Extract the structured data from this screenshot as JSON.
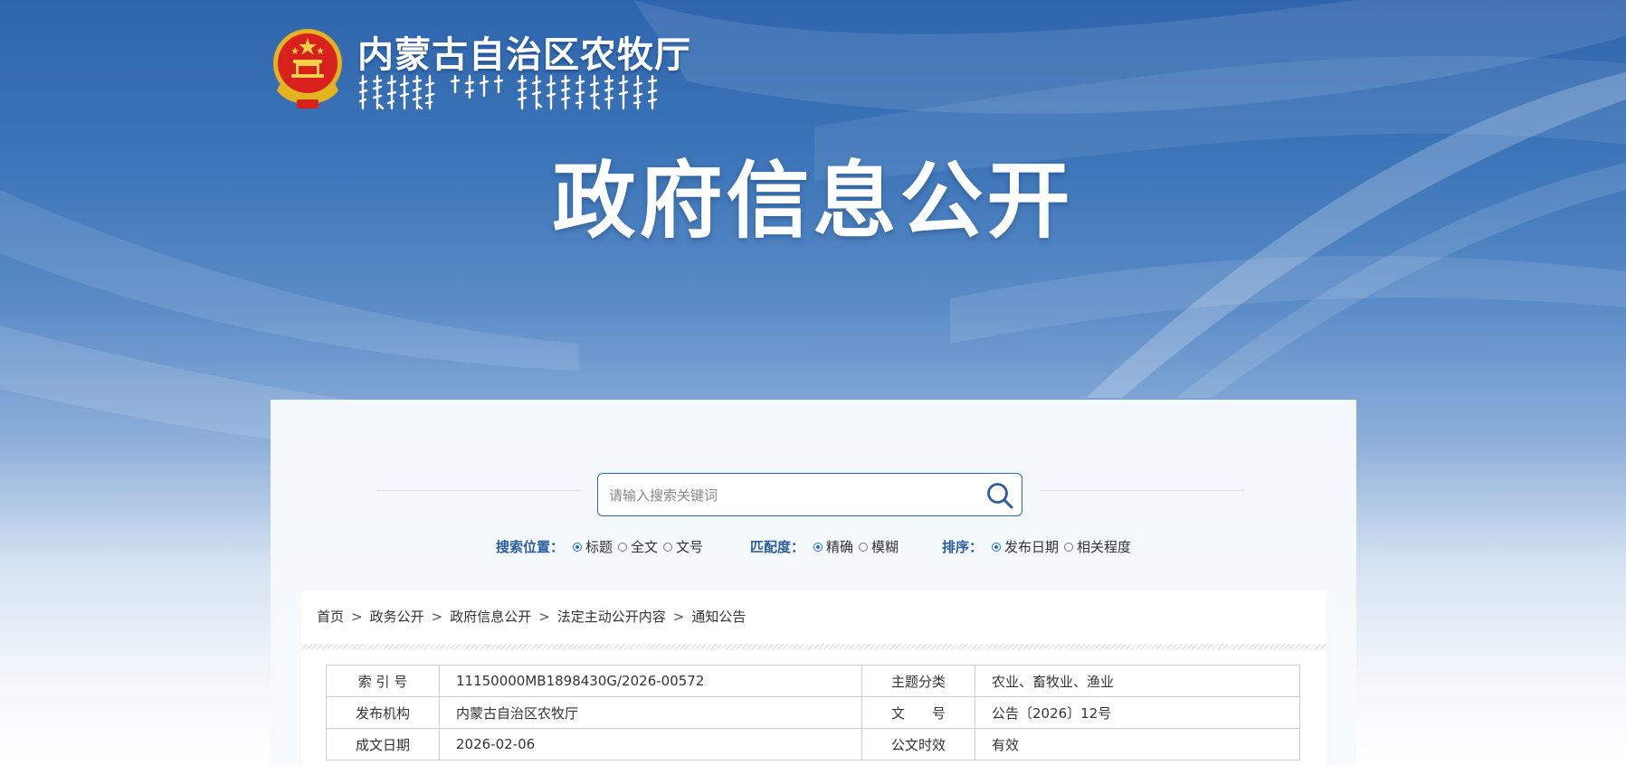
{
  "header": {
    "site_title": "内蒙古自治区农牧厅",
    "site_title_mongolian": "ᠥᠪᠥᠷ ᠮᠣᠩᠭᠣᠯ ᠤᠨ ᠥᠪᠡᠷᠲᠡᠭᠡᠨ ᠵᠠᠰᠠᠬᠤ ᠣᠷᠣᠨ ᠤ ᠬᠥᠳᠡᠭᠡ ᠠᠵᠤ ᠠᠬᠤᠢ ᠶᠢᠨ ᠲᠢᠩᠭᠠᠮ",
    "page_heading": "政府信息公开"
  },
  "search": {
    "placeholder": "请输入搜索关键词",
    "value": ""
  },
  "filters": {
    "position": {
      "label": "搜索位置：",
      "options": [
        "标题",
        "全文",
        "文号"
      ],
      "selected": "标题"
    },
    "match": {
      "label": "匹配度：",
      "options": [
        "精确",
        "模糊"
      ],
      "selected": "精确"
    },
    "sort": {
      "label": "排序：",
      "options": [
        "发布日期",
        "相关程度"
      ],
      "selected": "发布日期"
    }
  },
  "breadcrumb": [
    "首页",
    "政务公开",
    "政府信息公开",
    "法定主动公开内容",
    "通知公告"
  ],
  "breadcrumb_separator": ">",
  "meta_table": [
    {
      "k1": "索 引 号",
      "v1": "11150000MB1898430G/2026-00572",
      "k2": "主题分类",
      "v2": "农业、畜牧业、渔业"
    },
    {
      "k1": "发布机构",
      "v1": "内蒙古自治区农牧厅",
      "k2": "文　　号",
      "v2": "公告〔2026〕12号"
    },
    {
      "k1": "成文日期",
      "v1": "2026-02-06",
      "k2": "公文时效",
      "v2": "有效"
    }
  ],
  "colors": {
    "banner_blue": "#2f65ad",
    "accent": "#2a6bb0",
    "label_blue": "#2a5d9f",
    "radio_blue": "#1a6fd8"
  }
}
